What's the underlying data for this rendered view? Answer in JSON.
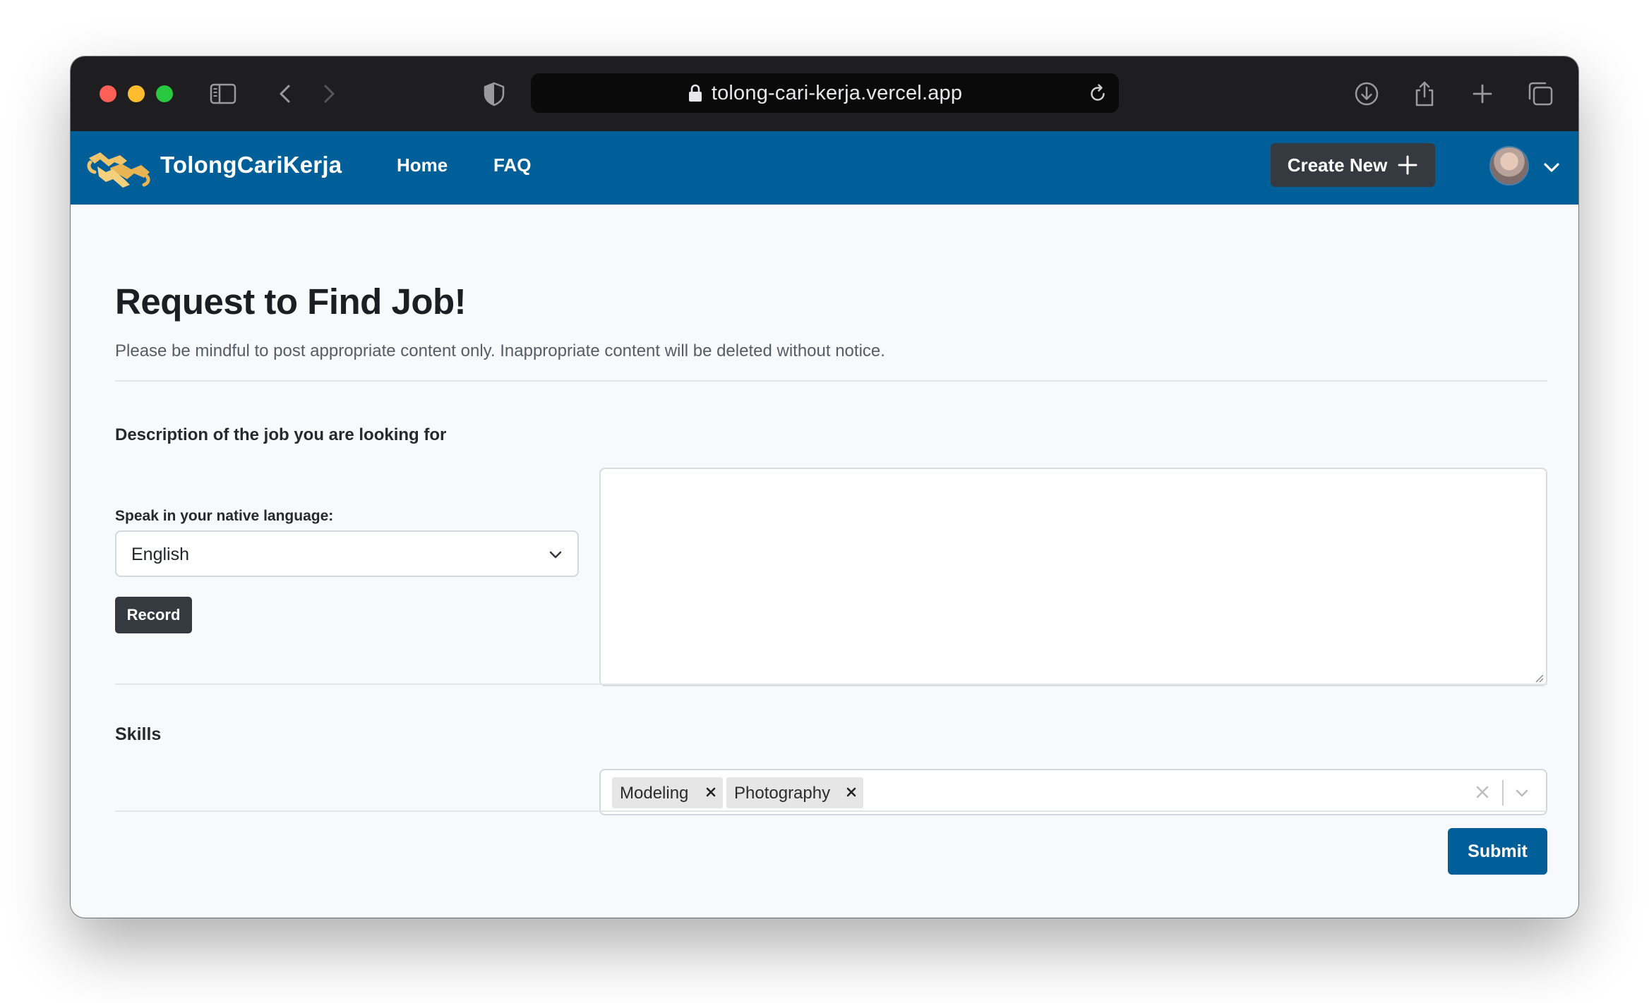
{
  "browser": {
    "url": "tolong-cari-kerja.vercel.app",
    "icons": [
      "sidebar-icon",
      "back-icon",
      "forward-icon",
      "shield-icon",
      "lock-icon",
      "reload-icon",
      "download-icon",
      "share-icon",
      "new-tab-icon",
      "tabs-overview-icon"
    ]
  },
  "navbar": {
    "brand": "TolongCariKerja",
    "links": [
      "Home",
      "FAQ"
    ],
    "create_label": "Create New",
    "color": "#005f99"
  },
  "page": {
    "title": "Request to Find Job!",
    "subtitle": "Please be mindful to post appropriate content only. Inappropriate content will be deleted without notice."
  },
  "form": {
    "description_label": "Description of the job you are looking for",
    "language_label": "Speak in your native language:",
    "language_value": "English",
    "record_label": "Record",
    "description_value": "",
    "skills_label": "Skills",
    "skills": [
      "Modeling",
      "Photography"
    ],
    "submit_label": "Submit"
  },
  "colors": {
    "primary": "#005f99",
    "dark_button": "#343a40",
    "background": "#f8f9fa"
  }
}
